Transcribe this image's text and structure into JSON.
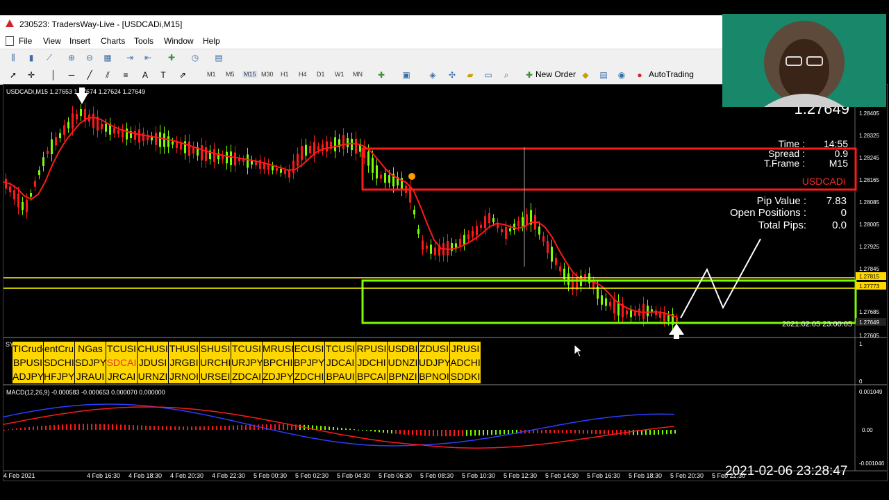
{
  "window": {
    "title": "230523: TradersWay-Live - [USDCADi,M15]"
  },
  "menu": [
    "File",
    "View",
    "Insert",
    "Charts",
    "Tools",
    "Window",
    "Help"
  ],
  "timeframes": [
    "M1",
    "M5",
    "M15",
    "M30",
    "H1",
    "H4",
    "D1",
    "W1",
    "MN"
  ],
  "toolbar": {
    "new_order": "New Order",
    "auto_trading": "AutoTrading"
  },
  "chart": {
    "header": "USDCADi,M15  1.27653 1.27674 1.27624 1.27649",
    "big_price": "1.27649",
    "info": {
      "time_label": "Time :",
      "time_value": "14:55",
      "spread_label": "Spread :",
      "spread_value": "0.9",
      "tframe_label": "T.Frame :",
      "tframe_value": "M15",
      "symbol": "USDCADi",
      "pip_label": "Pip Value :",
      "pip_value": "7.83",
      "open_label": "Open Positions :",
      "open_value": "0",
      "total_label": "Total Pips:",
      "total_value": "0.0"
    },
    "price_axis": [
      "1.28405",
      "1.28325",
      "1.28245",
      "1.28165",
      "1.28085",
      "1.28005",
      "1.27925",
      "1.27845",
      "1.27815",
      "1.27773",
      "1.27685",
      "1.27649",
      "1.27605"
    ],
    "date_stamp": "2021.02.05 23:00:05",
    "macd_label": "MACD(12,26,9) -0.000583 -0.000653 0.000070 0.000000",
    "macd_axis": [
      "0.001049",
      "0.00",
      "-0.001046"
    ],
    "sub_axis": [
      "1",
      "0"
    ],
    "time_axis": [
      "4 Feb 2021",
      "4 Feb 16:30",
      "4 Feb 18:30",
      "4 Feb 20:30",
      "4 Feb 22:30",
      "5 Feb 00:30",
      "5 Feb 02:30",
      "5 Feb 04:30",
      "5 Feb 06:30",
      "5 Feb 08:30",
      "5 Feb 10:30",
      "5 Feb 12:30",
      "5 Feb 14:30",
      "5 Feb 16:30",
      "5 Feb 18:30",
      "5 Feb 20:30",
      "5 Feb 22:30"
    ]
  },
  "symbol_grid": {
    "rows": [
      [
        "TICrude",
        "entCru",
        "NGas",
        "TCUSI",
        "CHUSI",
        "THUSI",
        "SHUSI",
        "TCUSI",
        "MRUSI",
        "ECUSI",
        "TCUSI",
        "RPUSI",
        "USDBI",
        "ZDUSI",
        "JRUSI",
        ""
      ],
      [
        "BPUSI",
        "SDCHI",
        "SDJPY",
        "SDCAI",
        "JDUSI",
        "JRGBI",
        "URCHI",
        "URJPY",
        "BPCHI",
        "BPJPY",
        "JDCAI",
        "JDCHI",
        "UDNZI",
        "UDJPY",
        "ADCHI",
        ""
      ],
      [
        "ADJPY",
        "HFJPY",
        "JRAUI",
        "JRCAI",
        "URNZI",
        "JRNOI",
        "URSEI",
        "ZDCAI",
        "ZDJPY",
        "ZDCHI",
        "BPAUI",
        "BPCAI",
        "BPNZI",
        "BPNOI",
        "SDDKI",
        ""
      ]
    ],
    "highlight": "SDCAI"
  },
  "clock": "2021-02-06  23:28:47",
  "colors": {
    "red": "#ff1a1a",
    "green": "#7cfc00",
    "yellow": "#ffff00",
    "blue": "#2d3dff",
    "bg": "#000000"
  }
}
